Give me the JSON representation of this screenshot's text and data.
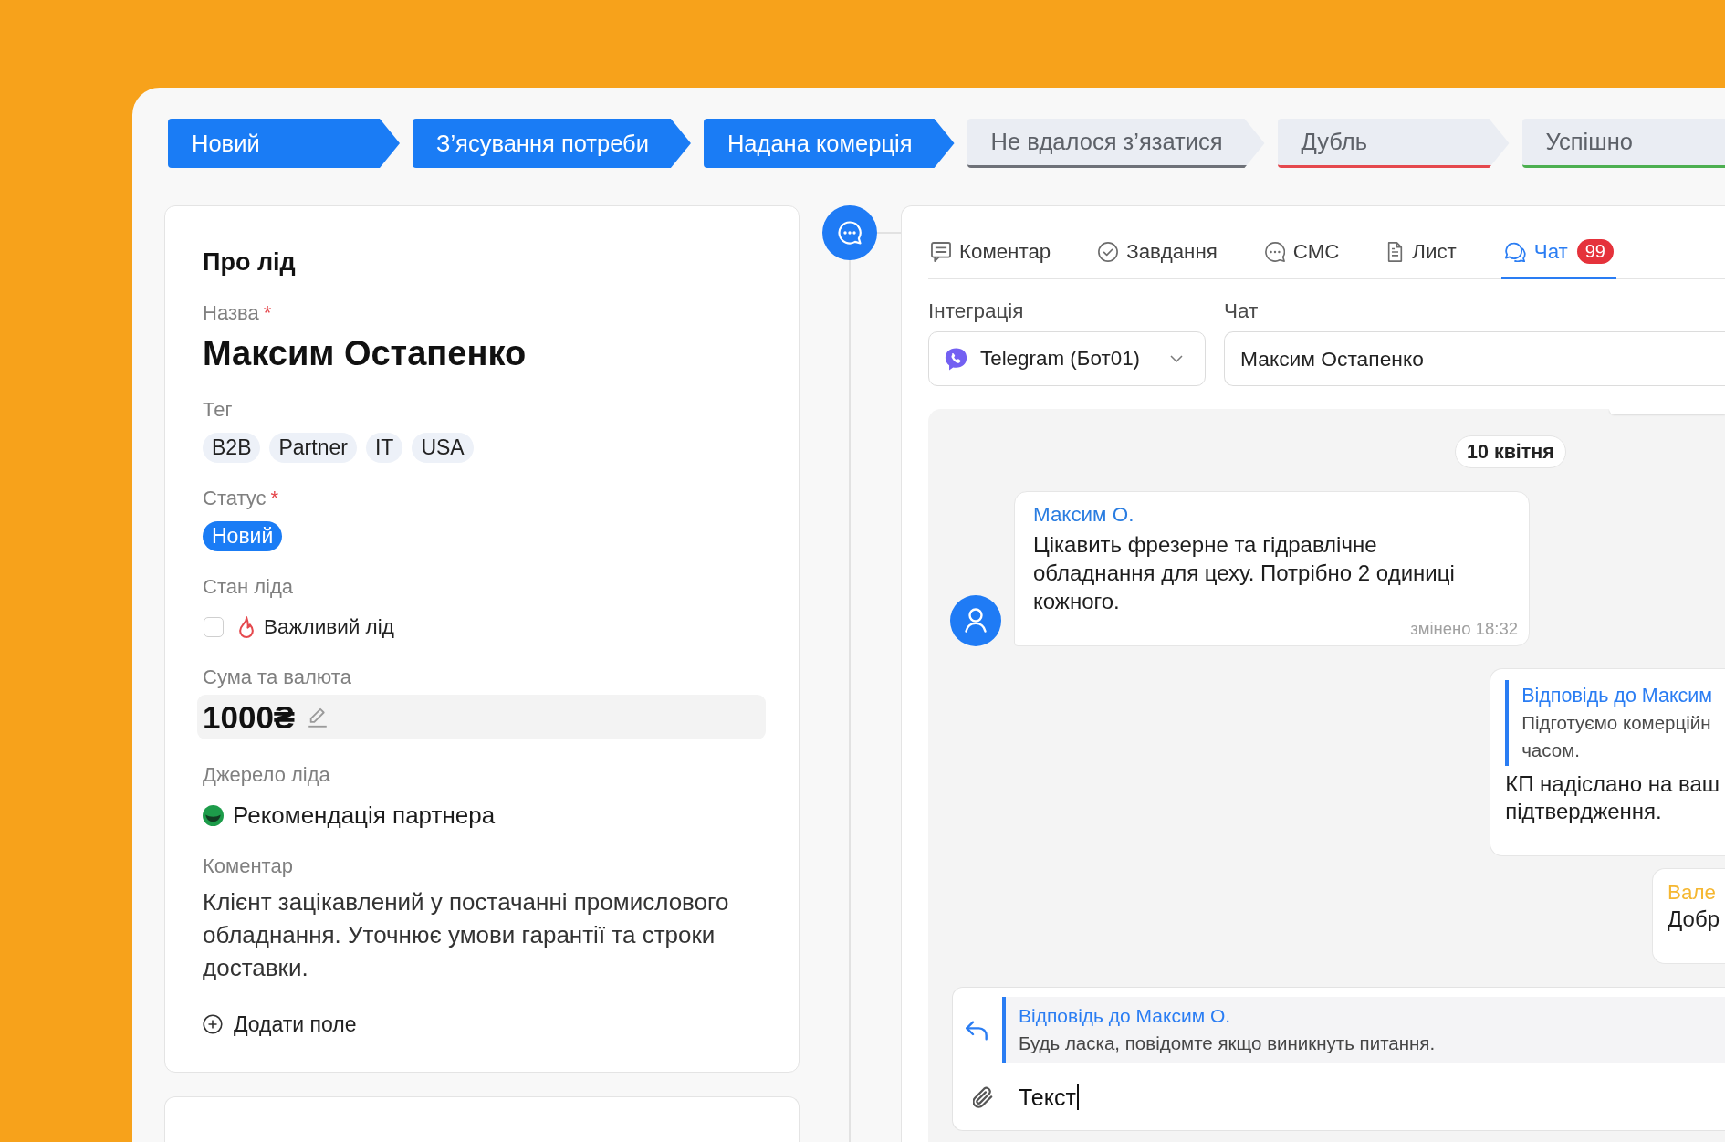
{
  "pipeline": [
    {
      "label": "Новий",
      "reached": true
    },
    {
      "label": "З’ясування потреби",
      "reached": true
    },
    {
      "label": "Надана комерція",
      "reached": true
    },
    {
      "label": "Не вдалося з’язатися",
      "reached": false,
      "color": "#6e7178"
    },
    {
      "label": "Дубль",
      "reached": false,
      "color": "#e5484d"
    },
    {
      "label": "Успішно",
      "reached": false,
      "color": "#4caf50"
    }
  ],
  "lead_card": {
    "title": "Про лід",
    "fields": [
      {
        "kind": "name",
        "label": "Назва",
        "required_mark": "*",
        "value": "Максим Остапенко"
      },
      {
        "kind": "tags",
        "label": "Тег",
        "tags": [
          "B2B",
          "Partner",
          "IT",
          "USA"
        ]
      },
      {
        "kind": "status",
        "label": "Статус",
        "required_mark": "*",
        "value": "Новий"
      },
      {
        "kind": "checkbox",
        "label": "Стан ліда",
        "option": "Важливий лід",
        "checked": false
      },
      {
        "kind": "amount",
        "label": "Сума та валюта",
        "value": "1000₴"
      },
      {
        "kind": "source",
        "label": "Джерело ліда",
        "value": "Рекомендація партнера"
      },
      {
        "kind": "text",
        "label": "Коментар",
        "value": "Клієнт зацікавлений у постачанні промислового обладнання. Уточнює умови гарантії та строки доставки."
      }
    ],
    "add_field": "Додати поле"
  },
  "activity": {
    "tabs": [
      {
        "kind": "comment",
        "label": "Коментар",
        "selected": false
      },
      {
        "kind": "task",
        "label": "Завдання",
        "selected": false
      },
      {
        "kind": "sms",
        "label": "СМС",
        "selected": false
      },
      {
        "kind": "letter",
        "label": "Лист",
        "selected": false
      },
      {
        "kind": "chat",
        "label": "Чат",
        "selected": true,
        "badge": "99"
      }
    ],
    "integration": {
      "label": "Інтеграція",
      "value": "Telegram (Бот01)"
    },
    "chat": {
      "label": "Чат",
      "value": "Максим Остапенко"
    },
    "date": "10 квітня",
    "messages": [
      {
        "kind": "incoming",
        "author": "Максим О.",
        "color": "#2a7de1",
        "text": "Цікавить фрезерне та гідравлічне обладнання для цеху. Потрібно 2 одиниці кожного.",
        "meta": "змінено 18:32"
      },
      {
        "kind": "outgoing",
        "quote": {
          "title": "Відповідь до Максим",
          "lines": [
            "Підготуємо комерційн",
            "часом."
          ]
        },
        "lines": [
          "КП надіслано на ваш",
          "підтвердження."
        ]
      },
      {
        "kind": "outgoing",
        "author": "Вале",
        "color": "#f5b731",
        "lines": [
          "Добр"
        ]
      }
    ],
    "composer": {
      "reply": {
        "title": "Відповідь до Максим О.",
        "text": "Будь ласка, повідомте якщо виникнуть питання."
      },
      "value": "Текст"
    }
  }
}
